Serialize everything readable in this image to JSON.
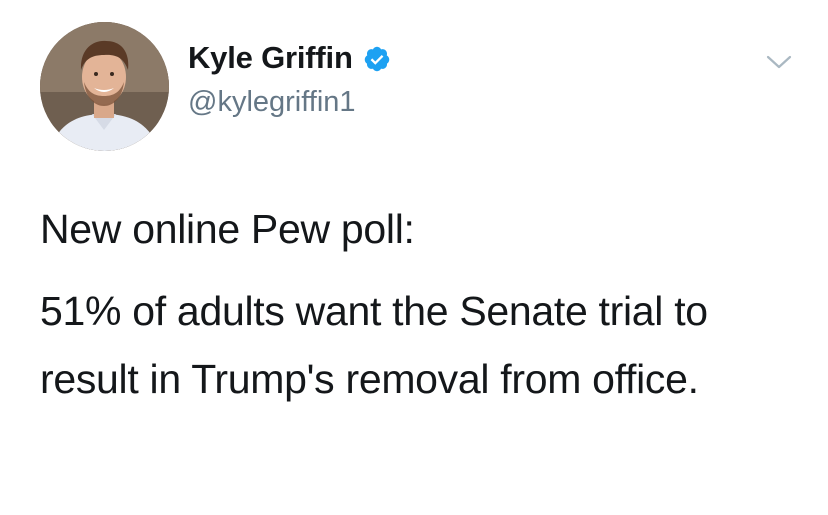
{
  "author": {
    "display_name": "Kyle Griffin",
    "handle": "@kylegriffin1",
    "verified": true,
    "avatar_icon": "profile-photo"
  },
  "tweet": {
    "paragraphs": [
      "New online Pew poll:",
      "51% of adults want the Senate trial to result in Trump's removal from office."
    ]
  },
  "colors": {
    "verified_badge": "#1da1f2",
    "text_primary": "#14171a",
    "text_secondary": "#657786",
    "chevron": "#aab8c2"
  },
  "icons": {
    "menu": "chevron-down-icon",
    "verified": "verified-badge-icon"
  }
}
